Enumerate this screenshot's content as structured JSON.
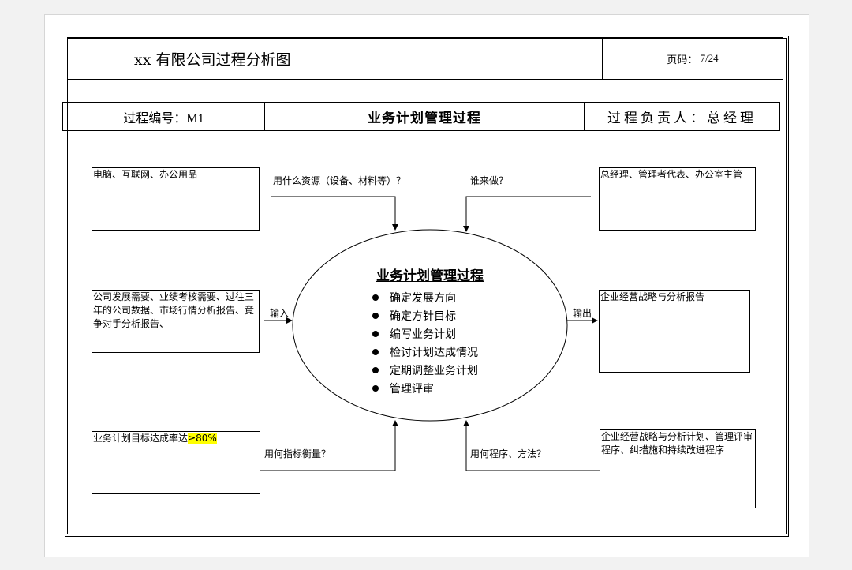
{
  "header": {
    "title": "xx 有限公司过程分析图",
    "page_label": "页码：",
    "page_value": "7/24"
  },
  "meta": {
    "process_code": "过程编号：M1",
    "process_name": "业务计划管理过程",
    "process_owner": "过程负责人：总经理"
  },
  "boxes": {
    "resources": "电脑、互联网、办公用品",
    "people": "总经理、管理者代表、办公室主管",
    "inputs": "公司发展需要、业绩考核需要、过往三年的公司数据、市场行情分析报告、竟争对手分析报告、",
    "outputs": "企业经营战略与分析报告",
    "metric_prefix": "业务计划目标达成率达",
    "metric_highlight": "≥80%",
    "procedures": "企业经营战略与分析计划、管理评审程序、纠措施和持续改进程序"
  },
  "labels": {
    "resources_q": "用什么资源（设备、材料等）？",
    "who_q": "谁来做？",
    "input": "输入",
    "output": "输出",
    "metric_q": "用何指标衡量？",
    "method_q": "用何程序、方法？"
  },
  "process": {
    "title": "业务计划管理过程",
    "steps": [
      "确定发展方向",
      "确定方针目标",
      "编写业务计划",
      "检讨计划达成情况",
      "定期调整业务计划",
      "管理评审"
    ]
  }
}
